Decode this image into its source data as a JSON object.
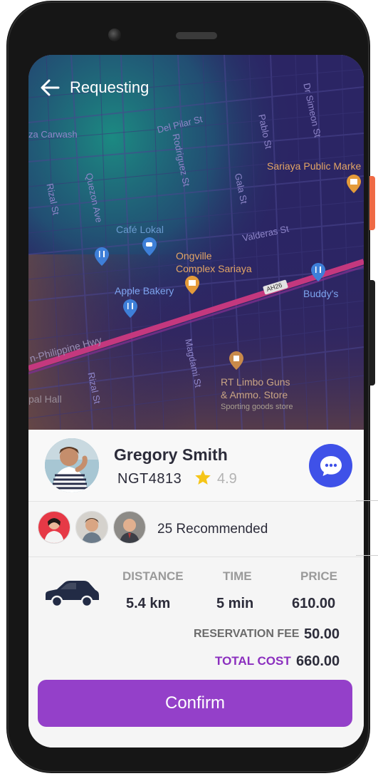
{
  "header": {
    "title": "Requesting"
  },
  "map": {
    "streets": [
      "Del Pilar St",
      "Dr Simeon St",
      "Pablo St",
      "Rodriguez St",
      "Gala St",
      "Quezon Ave",
      "Rizal St",
      "Valderas St",
      "Magdami St",
      "Rizal St",
      "AH26"
    ],
    "places": [
      "za Carwash",
      "Café Lokal",
      "Apple Bakery",
      "Sariaya Public Marke",
      "Buddy's",
      "pal Hall",
      "n-Philippine Hwy"
    ],
    "poi_ongville": [
      "Ongville",
      "Complex Sariaya"
    ],
    "poi_limbo": [
      "RT Limbo Guns",
      "& Ammo. Store"
    ],
    "poi_limbo_sub": "Sporting goods store"
  },
  "driver": {
    "name": "Gregory Smith",
    "plate": "NGT4813",
    "rating": "4.9"
  },
  "recommendations": {
    "label": "25 Recommended"
  },
  "trip": {
    "headers": {
      "distance": "DISTANCE",
      "time": "TIME",
      "price": "PRICE"
    },
    "values": {
      "distance": "5.4 km",
      "time": "5 min",
      "price": "610.00"
    },
    "reservation_fee_label": "RESERVATION FEE",
    "reservation_fee": "50.00",
    "total_label": "TOTAL COST",
    "total": "660.00"
  },
  "actions": {
    "confirm_label": "Confirm"
  },
  "colors": {
    "accent_purple": "#9440c9",
    "chat_blue": "#3f51e8",
    "star": "#f5c518",
    "total_purple": "#8b2fbf"
  },
  "icons": [
    "back-arrow-icon",
    "chat-bubble-icon",
    "star-icon",
    "car-icon",
    "map-pin-icon"
  ]
}
